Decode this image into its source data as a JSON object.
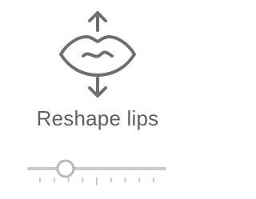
{
  "tool": {
    "icon": "reshape-lips-icon",
    "label": "Reshape lips"
  },
  "slider": {
    "value": 0.27,
    "tick_count": 9,
    "track_color": "#c9c9c9",
    "thumb_color": "#ffffff",
    "thumb_border_color": "#b8b8b8"
  },
  "colors": {
    "icon": "#6e6e6e",
    "label": "#5f5f5f"
  }
}
